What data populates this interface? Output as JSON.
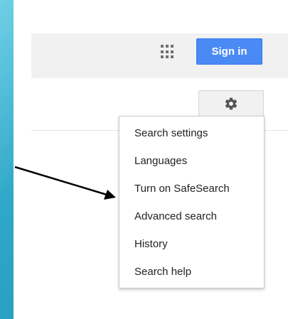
{
  "header": {
    "apps_icon": "apps-grid-icon",
    "sign_in_label": "Sign in"
  },
  "settings": {
    "gear_icon": "gear-icon",
    "menu_items": [
      "Search settings",
      "Languages",
      "Turn on SafeSearch",
      "Advanced search",
      "History",
      "Search help"
    ]
  },
  "colors": {
    "background": "#2fa9c6",
    "sign_in_button": "#4a8af4",
    "top_bar": "#f1f1f1"
  }
}
